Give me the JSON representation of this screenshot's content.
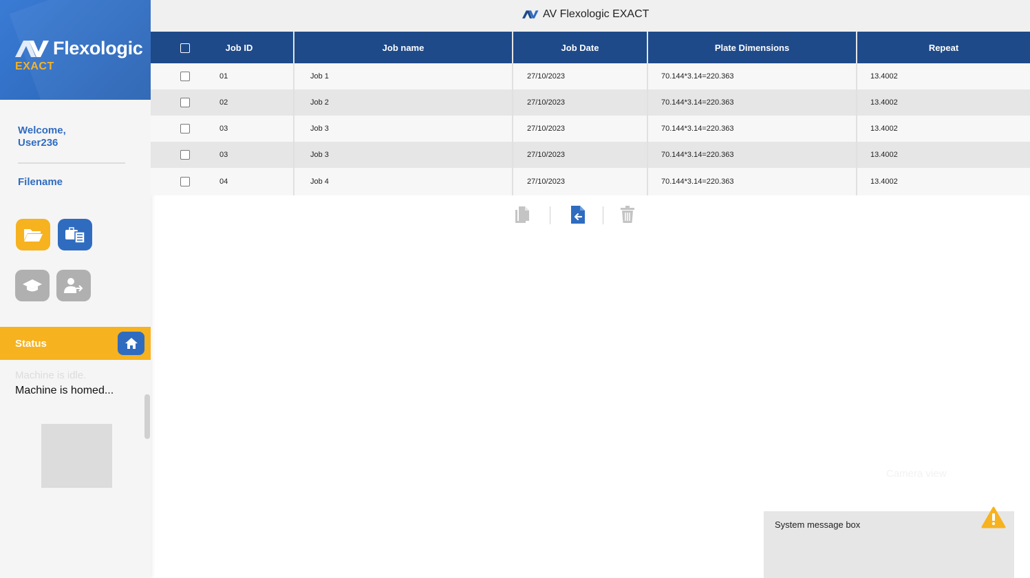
{
  "app": {
    "title": "AV Flexologic EXACT"
  },
  "sidebar": {
    "logo_text": "Flexologic",
    "logo_sub": "EXACT",
    "welcome_line1": "Welcome,",
    "welcome_line2": "User236",
    "filename_label": "Filename",
    "tiles": [
      {
        "name": "open-folder",
        "icon": "folder-open-icon",
        "color": "#f6b21f"
      },
      {
        "name": "job-list",
        "icon": "briefcase-list-icon",
        "color": "#2f6cc0"
      },
      {
        "name": "training",
        "icon": "graduation-cap-icon",
        "color": "#b0b0b0"
      },
      {
        "name": "logout-user",
        "icon": "user-exit-icon",
        "color": "#b0b0b0"
      }
    ],
    "status": {
      "label": "Status",
      "home_icon": "home-icon",
      "line_faded": "Machine is idle.",
      "line_current": "Machine is homed..."
    }
  },
  "table": {
    "headers": [
      "Job ID",
      "Job name",
      "Job Date",
      "Plate Dimensions",
      "Repeat"
    ],
    "rows": [
      {
        "id": "01",
        "name": "Job 1",
        "date": "27/10/2023",
        "plate": "70.144*3.14=220.363",
        "repeat": "13.4002"
      },
      {
        "id": "02",
        "name": "Job 2",
        "date": "27/10/2023",
        "plate": "70.144*3.14=220.363",
        "repeat": "13.4002"
      },
      {
        "id": "03",
        "name": "Job 3",
        "date": "27/10/2023",
        "plate": "70.144*3.14=220.363",
        "repeat": "13.4002"
      },
      {
        "id": "03",
        "name": "Job 3",
        "date": "27/10/2023",
        "plate": "70.144*3.14=220.363",
        "repeat": "13.4002"
      },
      {
        "id": "04",
        "name": "Job 4",
        "date": "27/10/2023",
        "plate": "70.144*3.14=220.363",
        "repeat": "13.4002"
      }
    ]
  },
  "toolbar": {
    "tools": [
      {
        "name": "copy",
        "icon": "copy-icon"
      },
      {
        "name": "import",
        "icon": "file-import-icon"
      },
      {
        "name": "delete",
        "icon": "trash-icon"
      }
    ]
  },
  "camera_view_label": "Camera view",
  "message_box": {
    "text": "System message box",
    "icon": "warning-icon"
  },
  "colors": {
    "primary": "#2f6cc0",
    "header": "#1e4a8a",
    "accent": "#f6b21f"
  }
}
